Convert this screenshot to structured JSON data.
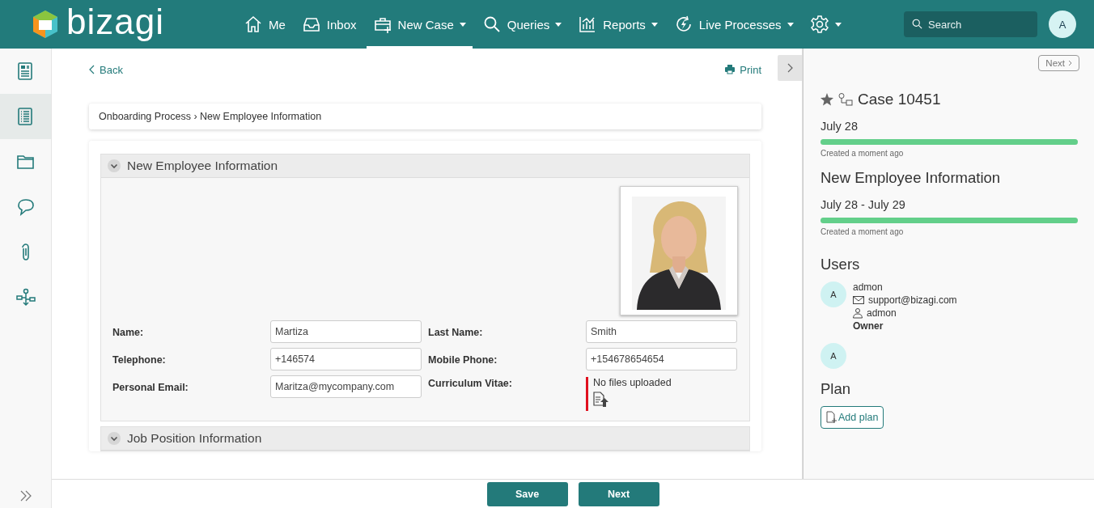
{
  "header": {
    "logo": "bizagi",
    "nav": [
      {
        "label": "Me",
        "kind": "home",
        "dropdown": false,
        "selected": false
      },
      {
        "label": "Inbox",
        "kind": "inbox",
        "dropdown": false,
        "selected": false
      },
      {
        "label": "New Case",
        "kind": "newcase",
        "dropdown": true,
        "selected": true
      },
      {
        "label": "Queries",
        "kind": "search",
        "dropdown": true,
        "selected": false
      },
      {
        "label": "Reports",
        "kind": "chart",
        "dropdown": true,
        "selected": false
      },
      {
        "label": "Live Processes",
        "kind": "live",
        "dropdown": true,
        "selected": false
      },
      {
        "kind": "gear",
        "dropdown": true,
        "selected": false
      }
    ],
    "search": {
      "placeholder": "Search"
    },
    "avatar": "A"
  },
  "sidebar": {
    "items": [
      {
        "kind": "form",
        "selected": false
      },
      {
        "kind": "list",
        "selected": true
      },
      {
        "kind": "folder",
        "selected": false
      },
      {
        "kind": "comment",
        "selected": false
      },
      {
        "kind": "attach",
        "selected": false
      },
      {
        "kind": "flow",
        "selected": false
      }
    ]
  },
  "main": {
    "back": "Back",
    "print": "Print",
    "breadcrumb": "Onboarding Process › New Employee Information",
    "sections": [
      {
        "title": "New Employee Information",
        "expanded": true,
        "photo": {
          "kind": "picture"
        },
        "fields": [
          {
            "label": "Name:",
            "kind": "text",
            "value": "Martiza"
          },
          {
            "label": "Last Name:",
            "kind": "text",
            "value": "Smith"
          },
          {
            "label": "Telephone:",
            "kind": "text",
            "value": "+146574"
          },
          {
            "label": "Mobile Phone:",
            "kind": "text",
            "value": "+154678654654"
          },
          {
            "label": "Personal Email:",
            "kind": "text",
            "value": "Maritza@mycompany.com"
          },
          {
            "label": "Curriculum Vitae:",
            "kind": "file",
            "value": "No files uploaded",
            "required": true
          }
        ]
      },
      {
        "title": "Job Position Information",
        "expanded": true
      }
    ]
  },
  "panel": {
    "next": "Next",
    "case": {
      "title": "Case 10451",
      "starred": true
    },
    "timeline": [
      {
        "dates": "July 28",
        "level": 1,
        "note": "Created a moment ago"
      },
      {
        "title": "New Employee Information",
        "dates": "July 28 - July 29",
        "level": 1,
        "note": "Created a moment ago"
      }
    ],
    "users_heading": "Users",
    "users": [
      {
        "initial": "A",
        "name": "admon",
        "email": "support@bizagi.com",
        "login": "admon",
        "role": "Owner"
      },
      {
        "initial": "A"
      }
    ],
    "plan_heading": "Plan",
    "add_plan": "Add plan"
  },
  "footer": {
    "buttons": [
      {
        "label": "Save"
      },
      {
        "label": "Next"
      }
    ]
  }
}
